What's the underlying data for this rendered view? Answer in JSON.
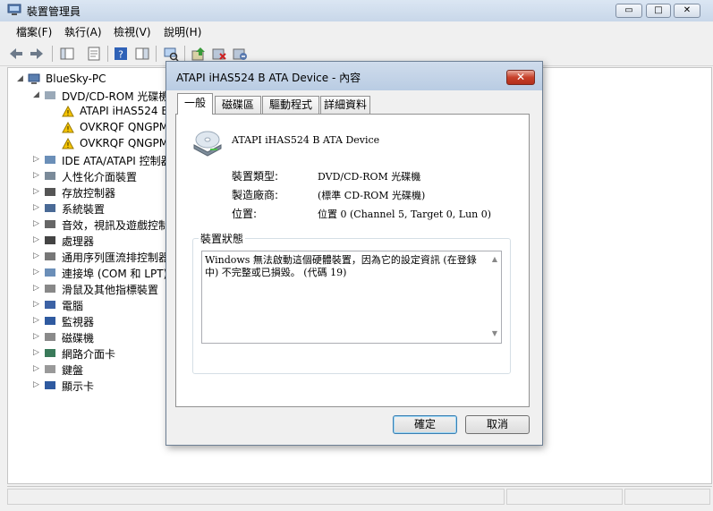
{
  "window": {
    "title": "裝置管理員",
    "min_label": "▭",
    "max_label": "□",
    "close_label": "✕"
  },
  "menu": [
    "檔案(F)",
    "執行(A)",
    "檢視(V)",
    "說明(H)"
  ],
  "toolbar": {
    "icons": [
      "back-icon",
      "forward-icon",
      "show-hide-tree-icon",
      "properties-icon",
      "help-icon",
      "action-pane-icon",
      "scan-hardware-icon",
      "update-driver-icon",
      "uninstall-icon",
      "disable-icon"
    ]
  },
  "tree": {
    "root": "BlueSky-PC",
    "items": [
      {
        "label": "DVD/CD-ROM 光碟機",
        "expander": "◢",
        "icon": "dvd-icon"
      },
      {
        "label": "ATAPI iHAS524   B",
        "expander": "",
        "icon": "warning-drive-icon"
      },
      {
        "label": "OVKRQF QNGPM",
        "expander": "",
        "icon": "warning-drive-icon"
      },
      {
        "label": "OVKRQF QNGPM",
        "expander": "",
        "icon": "warning-drive-icon"
      },
      {
        "label": "IDE ATA/ATAPI 控制器",
        "expander": "▷",
        "icon": "ide-controller-icon"
      },
      {
        "label": "人性化介面裝置",
        "expander": "▷",
        "icon": "hid-icon"
      },
      {
        "label": "存放控制器",
        "expander": "▷",
        "icon": "storage-controller-icon"
      },
      {
        "label": "系統裝置",
        "expander": "▷",
        "icon": "system-device-icon"
      },
      {
        "label": "音效，視訊及遊戲控制器",
        "expander": "▷",
        "icon": "sound-icon"
      },
      {
        "label": "處理器",
        "expander": "▷",
        "icon": "processor-icon"
      },
      {
        "label": "通用序列匯流排控制器",
        "expander": "▷",
        "icon": "usb-icon"
      },
      {
        "label": "連接埠 (COM 和 LPT)",
        "expander": "▷",
        "icon": "port-icon"
      },
      {
        "label": "滑鼠及其他指標裝置",
        "expander": "▷",
        "icon": "mouse-icon"
      },
      {
        "label": "電腦",
        "expander": "▷",
        "icon": "computer-icon"
      },
      {
        "label": "監視器",
        "expander": "▷",
        "icon": "monitor-icon"
      },
      {
        "label": "磁碟機",
        "expander": "▷",
        "icon": "disk-icon"
      },
      {
        "label": "網路介面卡",
        "expander": "▷",
        "icon": "network-icon"
      },
      {
        "label": "鍵盤",
        "expander": "▷",
        "icon": "keyboard-icon"
      },
      {
        "label": "顯示卡",
        "expander": "▷",
        "icon": "display-adapter-icon"
      }
    ]
  },
  "dialog": {
    "title": "ATAPI iHAS524   B ATA Device - 內容",
    "close_label": "✕",
    "tabs": [
      "一般",
      "磁碟區",
      "驅動程式",
      "詳細資料"
    ],
    "device_name": "ATAPI iHAS524   B ATA Device",
    "props": [
      {
        "label": "裝置類型:",
        "value": "DVD/CD-ROM 光碟機"
      },
      {
        "label": "製造廠商:",
        "value": "(標準 CD-ROM 光碟機)"
      },
      {
        "label": "位置:",
        "value": "位置 0 (Channel 5, Target 0, Lun 0)"
      }
    ],
    "status_legend": "裝置狀態",
    "status_text": "Windows 無法啟動這個硬體裝置，因為它的設定資訊 (在登錄中) 不完整或已損毀。 (代碼 19)",
    "ok_label": "確定",
    "cancel_label": "取消"
  }
}
